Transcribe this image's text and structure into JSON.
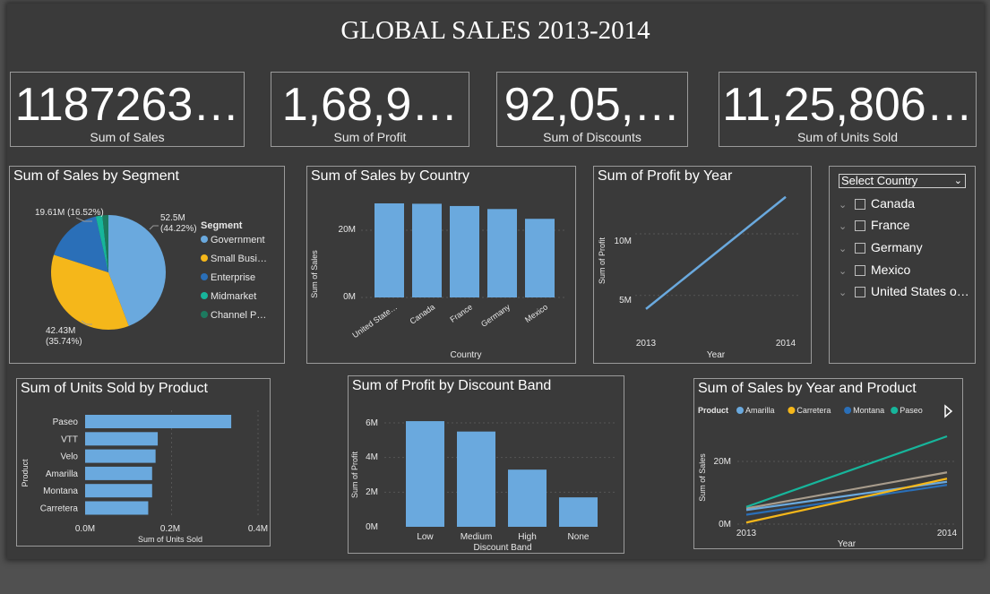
{
  "title": "GLOBAL SALES 2013-2014",
  "kpis": [
    {
      "value": "1187263…",
      "label": "Sum of  Sales"
    },
    {
      "value": "1,68,9…",
      "label": "Sum of Profit"
    },
    {
      "value": "92,05,…",
      "label": "Sum of Discounts"
    },
    {
      "value": "11,25,806…",
      "label": "Sum of Units Sold"
    }
  ],
  "segment_chart": {
    "title": "Sum of Sales by Segment",
    "legend_title": "Segment",
    "legend": [
      "Government",
      "Small Busi…",
      "Enterprise",
      "Midmarket",
      "Channel P…"
    ],
    "labels": {
      "government": "52.5M\n(44.22%)",
      "small_business": "42.43M\n(35.74%)",
      "enterprise": "19.61M\n(16.52%)"
    }
  },
  "country_chart": {
    "title": "Sum of Sales by Country",
    "xlabel": "Country",
    "ylabel": "Sum of Sales",
    "ticks": [
      "0M",
      "20M"
    ]
  },
  "profit_year_chart": {
    "title": "Sum of Profit by Year",
    "xlabel": "Year",
    "ylabel": "Sum of Profit",
    "ticks": [
      "5M",
      "10M"
    ],
    "x_ticks": [
      "2013",
      "2014"
    ]
  },
  "slicer": {
    "header": "Select Country",
    "items": [
      "Canada",
      "France",
      "Germany",
      "Mexico",
      "United States o…"
    ]
  },
  "units_chart": {
    "title": "Sum of Units Sold by Product",
    "xlabel": "Sum of Units Sold",
    "ylabel": "Product",
    "ticks": [
      "0.0M",
      "0.2M",
      "0.4M"
    ]
  },
  "discount_chart": {
    "title": "Sum of Profit by Discount Band",
    "xlabel": "Discount Band",
    "ylabel": "Sum of Profit",
    "ticks": [
      "0M",
      "2M",
      "4M",
      "6M"
    ]
  },
  "year_product_chart": {
    "title": "Sum of Sales by Year and Product",
    "xlabel": "Year",
    "ylabel": "Sum of Sales",
    "legend_title": "Product",
    "ticks": [
      "0M",
      "20M"
    ],
    "x_ticks": [
      "2013",
      "2014"
    ]
  },
  "colors": {
    "bar": "#6aa9de",
    "government": "#6aa9de",
    "small_business": "#f5b71a",
    "enterprise": "#2a6fb8",
    "midmarket": "#17b59b",
    "channel_partners": "#1d7a5f",
    "gray_line": "#a89c8c"
  },
  "chart_data": [
    {
      "type": "pie",
      "title": "Sum of Sales by Segment",
      "categories": [
        "Government",
        "Small Business",
        "Enterprise",
        "Midmarket",
        "Channel Partners"
      ],
      "values": [
        52.5,
        42.43,
        19.61,
        2.2,
        2.0
      ]
    },
    {
      "type": "bar",
      "title": "Sum of Sales by Country",
      "categories": [
        "United State…",
        "Canada",
        "France",
        "Germany",
        "Mexico"
      ],
      "values": [
        25.0,
        24.9,
        24.3,
        23.5,
        20.9
      ],
      "ylim": [
        0,
        30
      ],
      "xlabel": "Country",
      "ylabel": "Sum of Sales"
    },
    {
      "type": "line",
      "title": "Sum of Profit by Year",
      "x": [
        "2013",
        "2014"
      ],
      "values": [
        3.9,
        13.0
      ],
      "ylim": [
        2,
        14
      ],
      "xlabel": "Year",
      "ylabel": "Sum of Profit"
    },
    {
      "type": "bar",
      "orientation": "horizontal",
      "title": "Sum of Units Sold by Product",
      "categories": [
        "Paseo",
        "VTT",
        "Velo",
        "Amarilla",
        "Montana",
        "Carretera"
      ],
      "values": [
        0.338,
        0.168,
        0.163,
        0.155,
        0.155,
        0.146
      ],
      "xlim": [
        0,
        0.4
      ],
      "xlabel": "Sum of Units Sold",
      "ylabel": "Product"
    },
    {
      "type": "bar",
      "title": "Sum of Profit by Discount Band",
      "categories": [
        "Low",
        "Medium",
        "High",
        "None"
      ],
      "values": [
        6.1,
        5.5,
        3.3,
        1.7
      ],
      "ylim": [
        0,
        6.8
      ],
      "xlabel": "Discount Band",
      "ylabel": "Sum of Profit"
    },
    {
      "type": "line",
      "title": "Sum of Sales by Year and Product",
      "x": [
        "2013",
        "2014"
      ],
      "xlabel": "Year",
      "ylabel": "Sum of Sales",
      "ylim": [
        -2,
        40
      ],
      "series": [
        {
          "name": "Amarilla",
          "values": [
            4.5,
            13.5
          ]
        },
        {
          "name": "Carretera",
          "values": [
            0.5,
            14.5
          ]
        },
        {
          "name": "Montana",
          "values": [
            3.0,
            12.5
          ]
        },
        {
          "name": "Paseo",
          "values": [
            5.5,
            28.0
          ]
        },
        {
          "values": [
            5.0,
            16.5
          ]
        }
      ]
    }
  ]
}
